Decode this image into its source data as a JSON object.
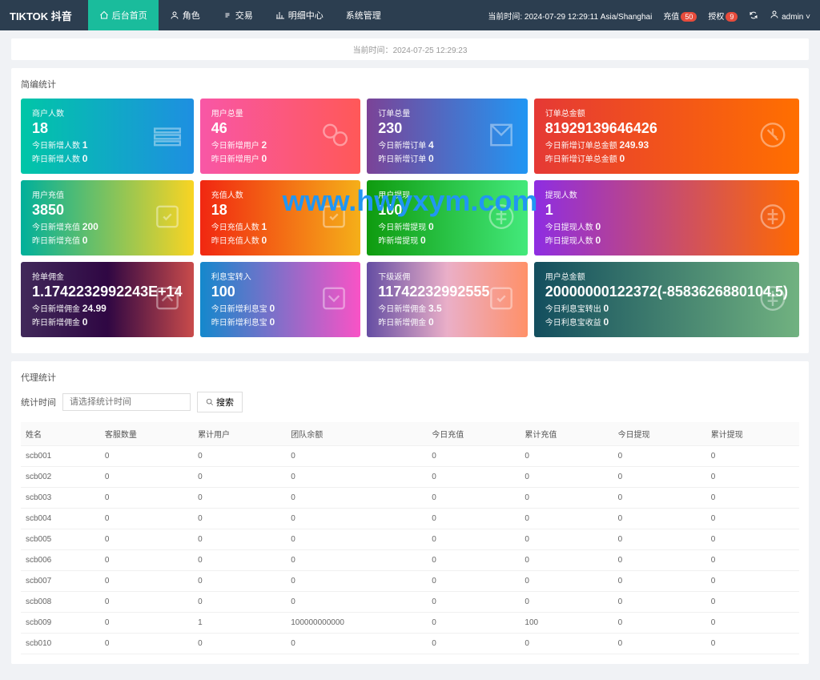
{
  "logo": "TIKTOK 抖音",
  "nav": [
    "后台首页",
    "角色",
    "交易",
    "明细中心",
    "系统管理"
  ],
  "header_time": "当前时间: 2024-07-29 12:29:11 Asia/Shanghai",
  "header_links": {
    "recharge": "充值",
    "auth": "授权",
    "admin": "admin"
  },
  "badges": {
    "recharge": "50",
    "auth": "9"
  },
  "time_label": "当前时间：",
  "time_value": "2024-07-25 12:29:23",
  "section1": "简编统计",
  "stats": [
    {
      "title": "商户人数",
      "value": "18",
      "l1": "今日新增人数",
      "n1": "1",
      "l2": "昨日新增人数",
      "n2": "0"
    },
    {
      "title": "用户总量",
      "value": "46",
      "l1": "今日新增用户",
      "n1": "2",
      "l2": "昨日新增用户",
      "n2": "0"
    },
    {
      "title": "订单总量",
      "value": "230",
      "l1": "今日新增订单",
      "n1": "4",
      "l2": "昨日新增订单",
      "n2": "0"
    },
    {
      "title": "订单总金额",
      "value": "81929139646426",
      "l1": "今日新增订单总金额",
      "n1": "249.93",
      "l2": "昨日新增订单总金额",
      "n2": "0"
    },
    {
      "title": "用户充值",
      "value": "3850",
      "l1": "今日新增充值",
      "n1": "200",
      "l2": "昨日新增充值",
      "n2": "0"
    },
    {
      "title": "充值人数",
      "value": "18",
      "l1": "今日充值人数",
      "n1": "1",
      "l2": "昨日充值人数",
      "n2": "0"
    },
    {
      "title": "用户提现",
      "value": "100",
      "l1": "今日新增提现",
      "n1": "0",
      "l2": "昨新增提现",
      "n2": "0"
    },
    {
      "title": "提现人数",
      "value": "1",
      "l1": "今日提现人数",
      "n1": "0",
      "l2": "昨日提现人数",
      "n2": "0"
    },
    {
      "title": "抢单佣金",
      "value": "1.1742232992243E+14",
      "l1": "今日新增佣金",
      "n1": "24.99",
      "l2": "昨日新增佣金",
      "n2": "0"
    },
    {
      "title": "利息宝转入",
      "value": "100",
      "l1": "今日新增利息宝",
      "n1": "0",
      "l2": "昨日新增利息宝",
      "n2": "0"
    },
    {
      "title": "下级返佣",
      "value": "11742232992555",
      "l1": "今日新增佣金",
      "n1": "3.5",
      "l2": "昨日新增佣金",
      "n2": "0"
    },
    {
      "title": "用户总金额",
      "value": "20000000122372(-8583626880104.5)",
      "l1": "今日利息宝转出",
      "n1": "0",
      "l2": "今日利息宝收益",
      "n2": "0"
    }
  ],
  "section2": "代理统计",
  "filter_label": "统计时间",
  "filter_placeholder": "请选择统计时间",
  "search": "搜索",
  "cols": [
    "姓名",
    "客服数量",
    "累计用户",
    "团队余额",
    "今日充值",
    "累计充值",
    "今日提现",
    "累计提现"
  ],
  "rows": [
    {
      "c": [
        "scb001",
        "0",
        "0",
        "0",
        "0",
        "0",
        "0",
        "0"
      ]
    },
    {
      "c": [
        "scb002",
        "0",
        "0",
        "0",
        "0",
        "0",
        "0",
        "0"
      ]
    },
    {
      "c": [
        "scb003",
        "0",
        "0",
        "0",
        "0",
        "0",
        "0",
        "0"
      ]
    },
    {
      "c": [
        "scb004",
        "0",
        "0",
        "0",
        "0",
        "0",
        "0",
        "0"
      ]
    },
    {
      "c": [
        "scb005",
        "0",
        "0",
        "0",
        "0",
        "0",
        "0",
        "0"
      ]
    },
    {
      "c": [
        "scb006",
        "0",
        "0",
        "0",
        "0",
        "0",
        "0",
        "0"
      ]
    },
    {
      "c": [
        "scb007",
        "0",
        "0",
        "0",
        "0",
        "0",
        "0",
        "0"
      ]
    },
    {
      "c": [
        "scb008",
        "0",
        "0",
        "0",
        "0",
        "0",
        "0",
        "0"
      ]
    },
    {
      "c": [
        "scb009",
        "0",
        "1",
        "100000000000",
        "0",
        "100",
        "0",
        "0"
      ]
    },
    {
      "c": [
        "scb010",
        "0",
        "0",
        "0",
        "0",
        "0",
        "0",
        "0"
      ]
    }
  ],
  "watermark": "www.hwyxym.com"
}
